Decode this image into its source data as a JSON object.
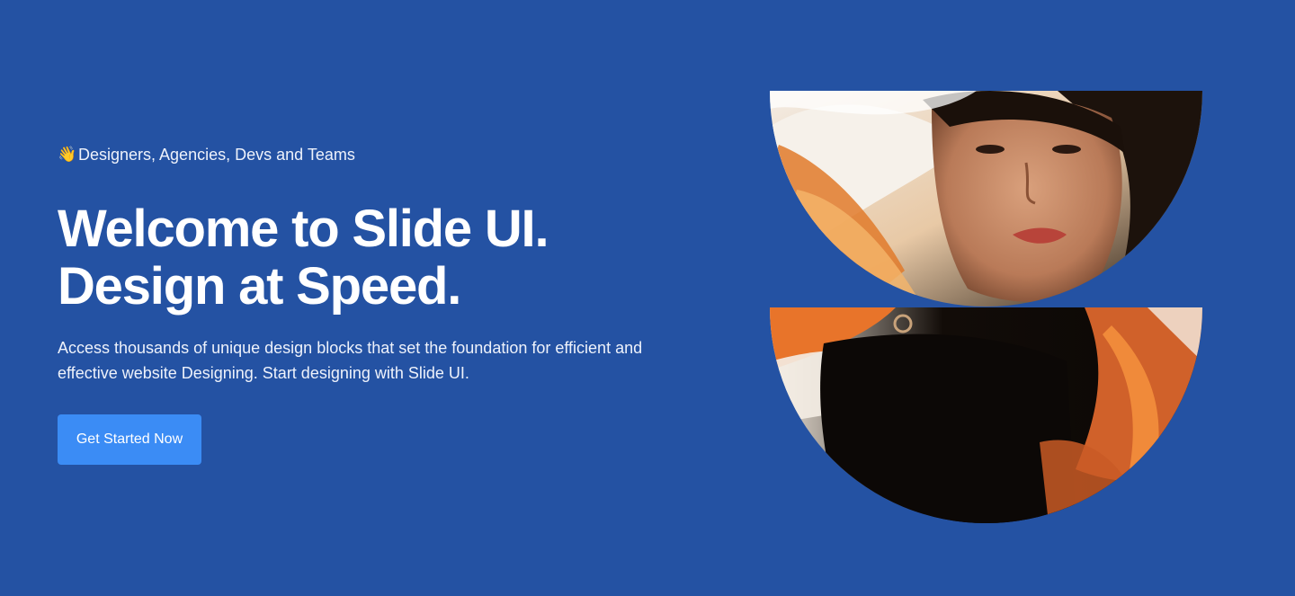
{
  "hero": {
    "eyebrow_icon": "waving-hand-icon",
    "eyebrow_emoji": "👋",
    "eyebrow": "Designers, Agencies, Devs and Teams",
    "title_line1": "Welcome to Slide UI.",
    "title_line2": "Design at Speed.",
    "description": "Access thousands of unique design blocks that set the foundation for efficient and effective website Designing. Start designing with Slide UI.",
    "cta_label": "Get Started Now"
  },
  "colors": {
    "background": "#2452a3",
    "cta": "#3b8cf5",
    "text": "#ffffff"
  }
}
